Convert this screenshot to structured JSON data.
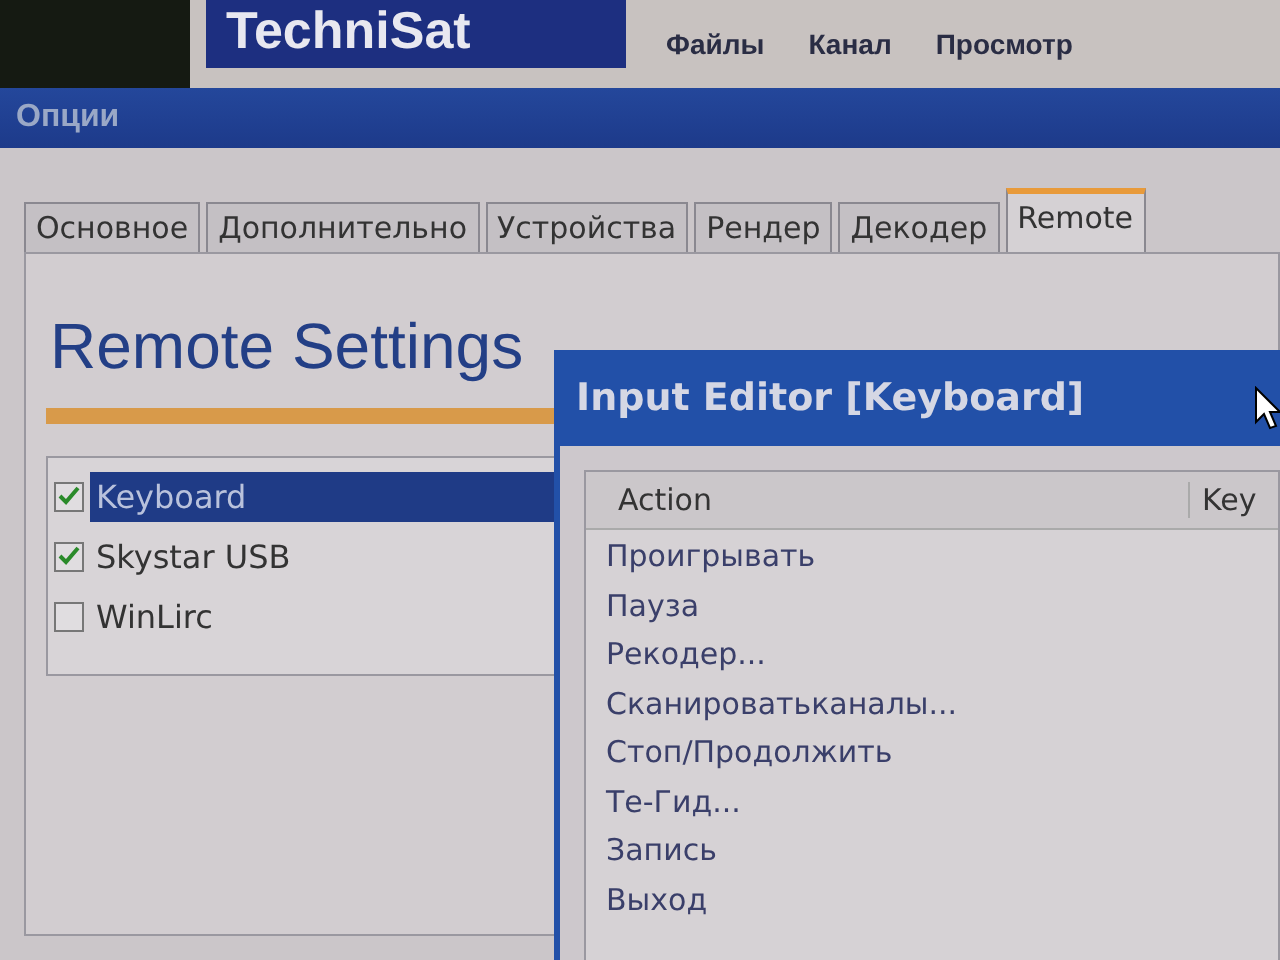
{
  "app": {
    "logo": "TechniSat",
    "menu": [
      "Файлы",
      "Канал",
      "Просмотр"
    ]
  },
  "options_window": {
    "title": "Опции",
    "tabs": [
      {
        "label": "Основное",
        "selected": false
      },
      {
        "label": "Дополнительно",
        "selected": false
      },
      {
        "label": "Устройства",
        "selected": false
      },
      {
        "label": "Рендер",
        "selected": false
      },
      {
        "label": "Декодер",
        "selected": false
      },
      {
        "label": "Remote",
        "selected": true
      }
    ],
    "heading": "Remote Settings",
    "devices": [
      {
        "label": "Keyboard",
        "checked": true,
        "selected": true
      },
      {
        "label": "Skystar USB",
        "checked": true,
        "selected": false
      },
      {
        "label": "WinLirc",
        "checked": false,
        "selected": false
      }
    ]
  },
  "input_editor": {
    "title": "Input Editor [Keyboard]",
    "columns": [
      "Action",
      "Key"
    ],
    "rows": [
      "Проигрывать",
      "Пауза",
      "Рекодер...",
      "Сканироватьканалы...",
      "Стоп/Продолжить",
      "Те-Гид...",
      "Запись",
      "Выход"
    ]
  }
}
